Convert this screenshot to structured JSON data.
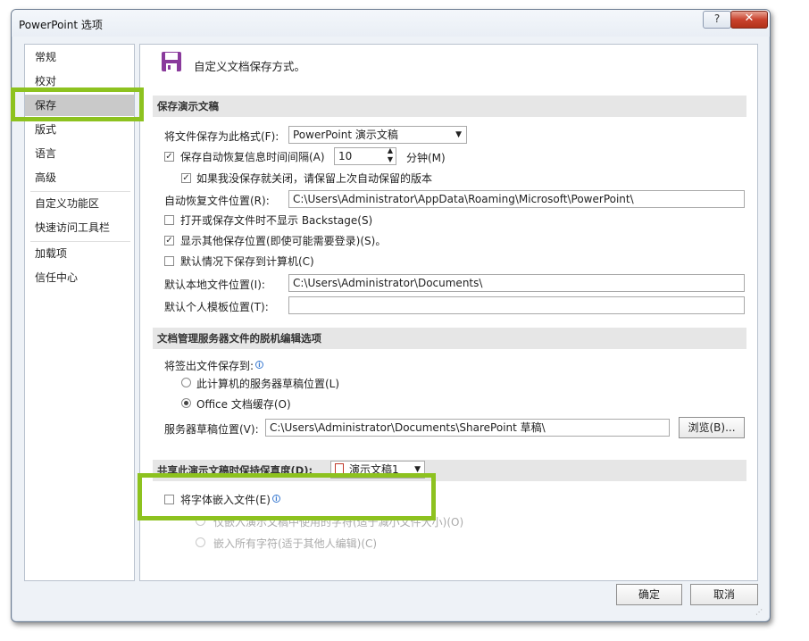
{
  "window": {
    "title": "PowerPoint 选项",
    "help_label": "?",
    "close_label": "✕"
  },
  "nav": {
    "items": [
      "常规",
      "校对",
      "保存",
      "版式",
      "语言",
      "高级",
      "自定义功能区",
      "快速访问工具栏",
      "加载项",
      "信任中心"
    ],
    "selected": "保存"
  },
  "header": {
    "title": "自定义文档保存方式。",
    "icon": "save-disk-icon"
  },
  "save_section": {
    "title": "保存演示文稿",
    "format_label": "将文件保存为此格式(F):",
    "format_value": "PowerPoint 演示文稿",
    "autorecover_label": "保存自动恢复信息时间间隔(A)",
    "autorecover_checked": true,
    "autorecover_minutes": "10",
    "minutes_label": "分钟(M)",
    "keep_last_label": "如果我没保存就关闭，请保留上次自动保留的版本",
    "keep_last_checked": true,
    "autorecover_location_label": "自动恢复文件位置(R):",
    "autorecover_location_value": "C:\\Users\\Administrator\\AppData\\Roaming\\Microsoft\\PowerPoint\\",
    "no_backstage_label": "打开或保存文件时不显示 Backstage(S)",
    "no_backstage_checked": false,
    "show_other_label": "显示其他保存位置(即使可能需要登录)(S)。",
    "show_other_checked": true,
    "save_to_computer_label": "默认情况下保存到计算机(C)",
    "save_to_computer_checked": false,
    "default_local_label": "默认本地文件位置(I):",
    "default_local_value": "C:\\Users\\Administrator\\Documents\\",
    "personal_templates_label": "默认个人模板位置(T):",
    "personal_templates_value": ""
  },
  "offline_section": {
    "title": "文档管理服务器文件的脱机编辑选项",
    "checkout_label": "将签出文件保存到:",
    "option_server_drafts": "此计算机的服务器草稿位置(L)",
    "option_office_cache": "Office 文档缓存(O)",
    "selected_option": "Office 文档缓存(O)",
    "drafts_location_label": "服务器草稿位置(V):",
    "drafts_location_value": "C:\\Users\\Administrator\\Documents\\SharePoint 草稿\\",
    "browse_label": "浏览(B)..."
  },
  "fidelity_section": {
    "title": "共享此演示文稿时保持保真度(D):",
    "presentation_value": "演示文稿1",
    "embed_fonts_label": "将字体嵌入文件(E)",
    "embed_fonts_checked": false,
    "embed_used_label": "仅嵌入演示文稿中使用的字符(适于减小文件大小)(O)",
    "embed_all_label": "嵌入所有字符(适于其他人编辑)(C)"
  },
  "footer": {
    "ok_label": "确定",
    "cancel_label": "取消"
  },
  "colors": {
    "highlight": "#8dc21f",
    "nav_selected": "#c9c9c9",
    "section_bg": "#e6e6e6",
    "dialog_bg": "#eef2f7"
  }
}
